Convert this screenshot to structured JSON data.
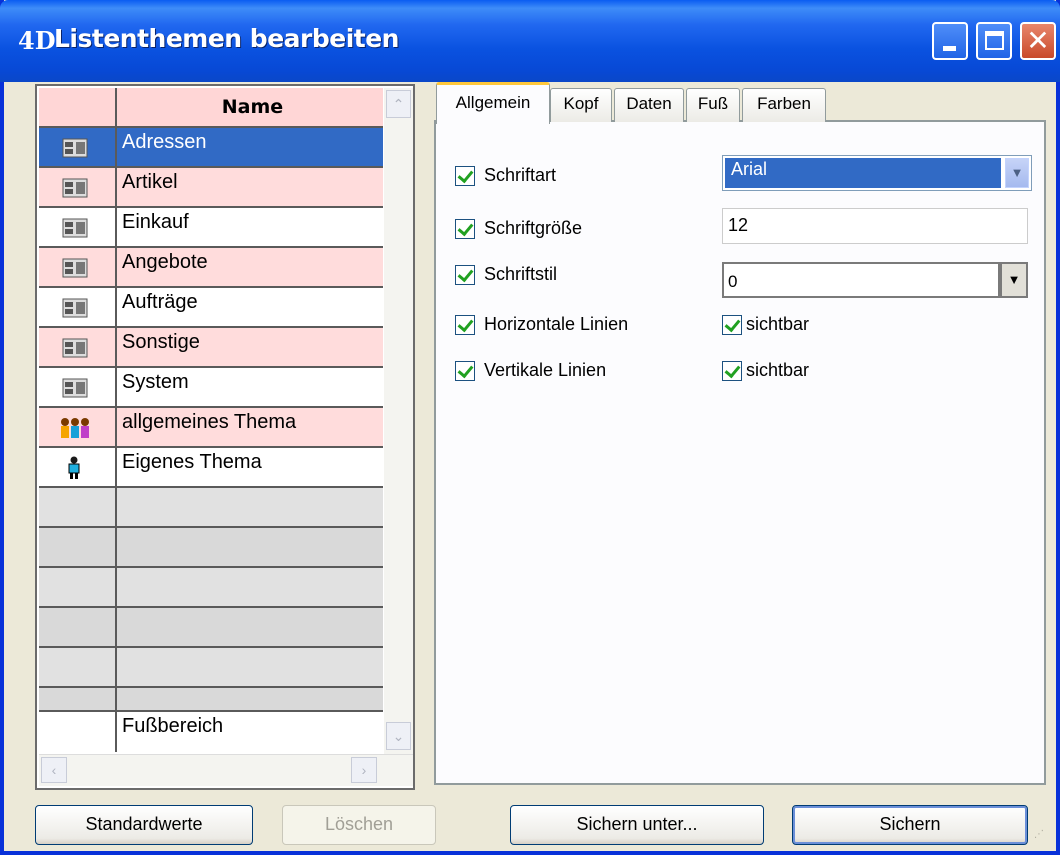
{
  "window": {
    "title": "Listenthemen bearbeiten",
    "logo": "4D",
    "controls": {
      "minimize": "minimize-icon",
      "maximize": "maximize-icon",
      "close": "close-icon"
    }
  },
  "list": {
    "header": "Name",
    "rows": [
      {
        "label": "Adressen",
        "icon": "table-icon",
        "selected": true
      },
      {
        "label": "Artikel",
        "icon": "table-icon"
      },
      {
        "label": "Einkauf",
        "icon": "table-icon"
      },
      {
        "label": "Angebote",
        "icon": "table-icon"
      },
      {
        "label": "Aufträge",
        "icon": "table-icon"
      },
      {
        "label": "Sonstige",
        "icon": "table-icon"
      },
      {
        "label": "System",
        "icon": "table-icon"
      },
      {
        "label": "allgemeines Thema",
        "icon": "group-icon"
      },
      {
        "label": "Eigenes Thema",
        "icon": "person-icon"
      }
    ],
    "footer": "Fußbereich"
  },
  "tabs": [
    {
      "label": "Allgemein",
      "active": true
    },
    {
      "label": "Kopf"
    },
    {
      "label": "Daten"
    },
    {
      "label": "Fuß"
    },
    {
      "label": "Farben"
    }
  ],
  "general": {
    "font": {
      "label": "Schriftart",
      "checked": true,
      "value": "Arial"
    },
    "size": {
      "label": "Schriftgröße",
      "checked": true,
      "value": "12"
    },
    "style": {
      "label": "Schriftstil",
      "checked": true,
      "value": "0"
    },
    "hlines": {
      "label": "Horizontale Linien",
      "checked": true,
      "visible_label": "sichtbar",
      "visible": true
    },
    "vlines": {
      "label": "Vertikale Linien",
      "checked": true,
      "visible_label": "sichtbar",
      "visible": true
    }
  },
  "buttons": {
    "defaults": "Standardwerte",
    "delete": "Löschen",
    "save_as": "Sichern unter...",
    "save": "Sichern"
  },
  "colors": {
    "titlebar": "#0a52e0",
    "selection": "#316ac5",
    "row_pink": "#ffdcdc",
    "check": "#21a121"
  }
}
